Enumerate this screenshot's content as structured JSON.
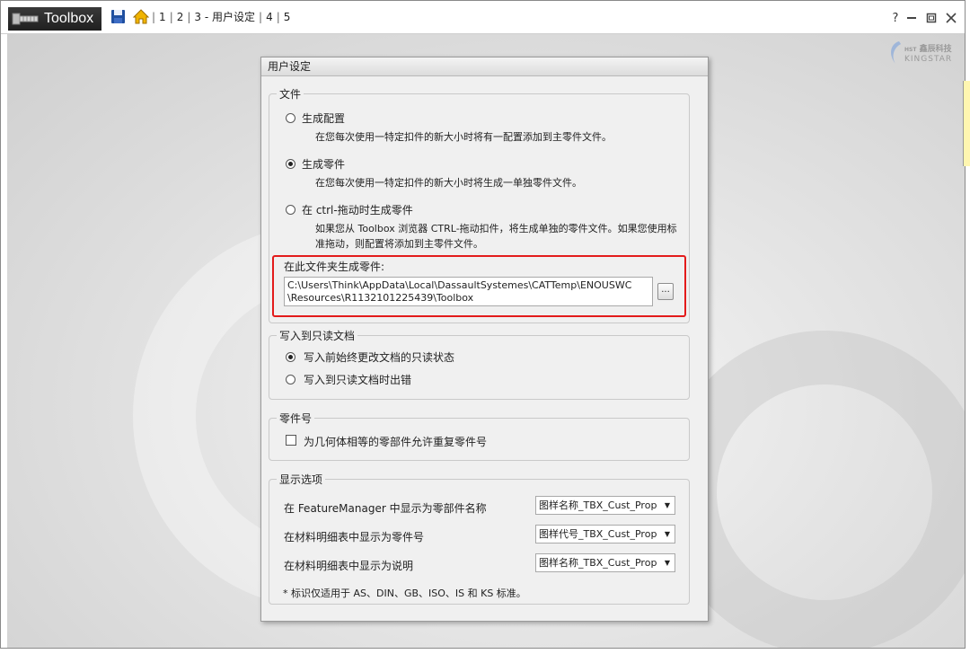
{
  "toolbar": {
    "app_title": "Toolbox",
    "breadcrumbs": [
      "1",
      "2",
      "3 - 用户设定",
      "4",
      "5"
    ],
    "icons": [
      "bolt-icon",
      "save-icon",
      "home-icon",
      "help-icon",
      "minimize-icon",
      "restore-icon",
      "close-icon"
    ],
    "help_label": "?"
  },
  "logo": {
    "text": "鑫辰科技",
    "sub": "KINGSTAR",
    "prefix": "HST"
  },
  "dialog": {
    "title": "用户设定",
    "file_group": {
      "title": "文件",
      "options": [
        {
          "label": "生成配置",
          "desc": "在您每次使用一特定扣件的新大小时将有一配置添加到主零件文件。",
          "selected": false
        },
        {
          "label": "生成零件",
          "desc": "在您每次使用一特定扣件的新大小时将生成一单独零件文件。",
          "selected": true
        },
        {
          "label": "在 ctrl-拖动时生成零件",
          "desc": "如果您从 Toolbox 浏览器 CTRL-拖动扣件，将生成单独的零件文件。如果您使用标准拖动，则配置将添加到主零件文件。",
          "selected": false
        }
      ],
      "folder_label": "在此文件夹生成零件:",
      "folder_path": "C:\\Users\\Think\\AppData\\Local\\DassaultSystemes\\CATTemp\\ENOUSWC\n\\Resources\\R1132101225439\\Toolbox",
      "browse_label": "..."
    },
    "readonly_group": {
      "title": "写入到只读文档",
      "options": [
        {
          "label": "写入前始终更改文档的只读状态",
          "selected": true
        },
        {
          "label": "写入到只读文档时出错",
          "selected": false
        }
      ]
    },
    "partno_group": {
      "title": "零件号",
      "checkbox_label": "为几何体相等的零部件允许重复零件号",
      "checked": false
    },
    "display_group": {
      "title": "显示选项",
      "rows": [
        {
          "label": "在 FeatureManager 中显示为零部件名称",
          "value": "图样名称_TBX_Cust_Prop"
        },
        {
          "label": "在材料明细表中显示为零件号",
          "value": "图样代号_TBX_Cust_Prop"
        },
        {
          "label": "在材料明细表中显示为说明",
          "value": "图样名称_TBX_Cust_Prop"
        }
      ],
      "note": "* 标识仅适用于 AS、DIN、GB、ISO、IS 和 KS 标准。"
    }
  },
  "colors": {
    "highlight_box": "#e31b1b",
    "dialog_bg": "#f0f0f0",
    "brand_bar": "#2b2b2b"
  }
}
